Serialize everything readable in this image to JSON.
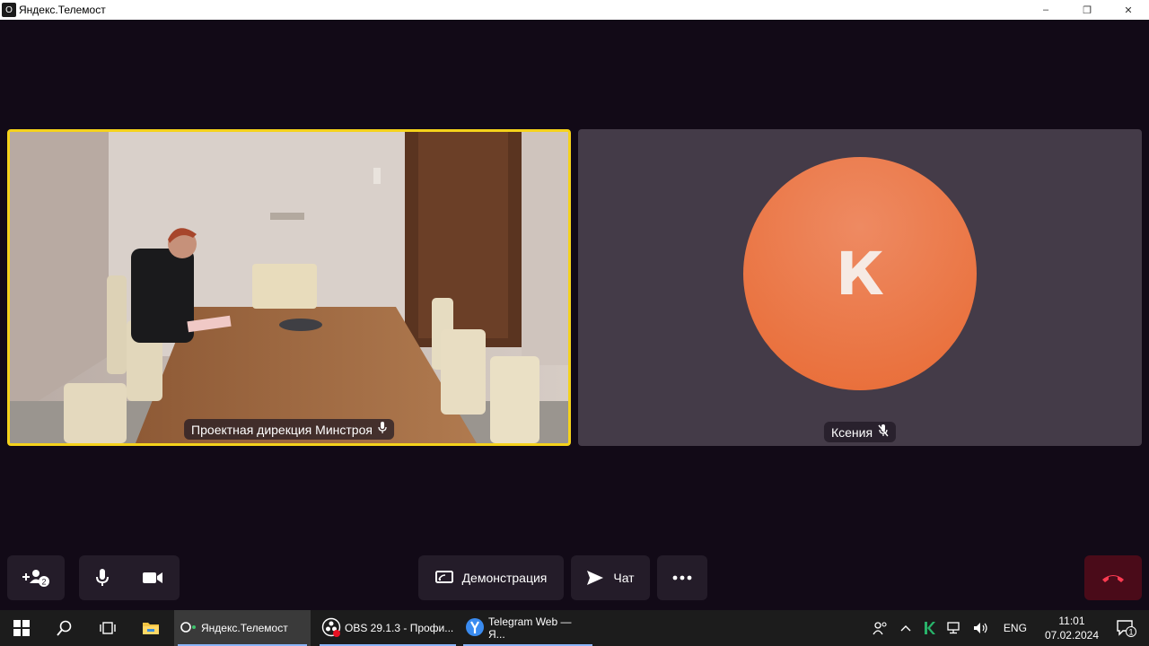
{
  "window": {
    "title": "Яндекс.Телемост",
    "buttons": [
      "–",
      "❐",
      "✕"
    ]
  },
  "participants": [
    {
      "name": "Проектная дирекция Минстроя",
      "mic": "on",
      "active_speaker": true
    },
    {
      "name": "Ксения",
      "mic": "muted",
      "avatar_letter": "К",
      "avatar_color": "#e8743f"
    }
  ],
  "controls": {
    "invite_badge": "2",
    "screen_share_label": "Демонстрация",
    "chat_label": "Чат"
  },
  "colors": {
    "background": "#120a17",
    "active_border": "#f5d21b",
    "control_bg": "#241c29",
    "hangup_bg": "#4a0b19",
    "hangup_icon": "#ff3b52"
  },
  "taskbar": {
    "apps": [
      {
        "label": "Яндекс.Телемост",
        "active": true
      },
      {
        "label": "OBS 29.1.3 - Профи...",
        "active": false
      },
      {
        "label": "Telegram Web — Я...",
        "active": false
      }
    ],
    "tray": {
      "language": "ENG",
      "time": "11:01",
      "date": "07.02.2024",
      "notification_count": "1"
    }
  }
}
